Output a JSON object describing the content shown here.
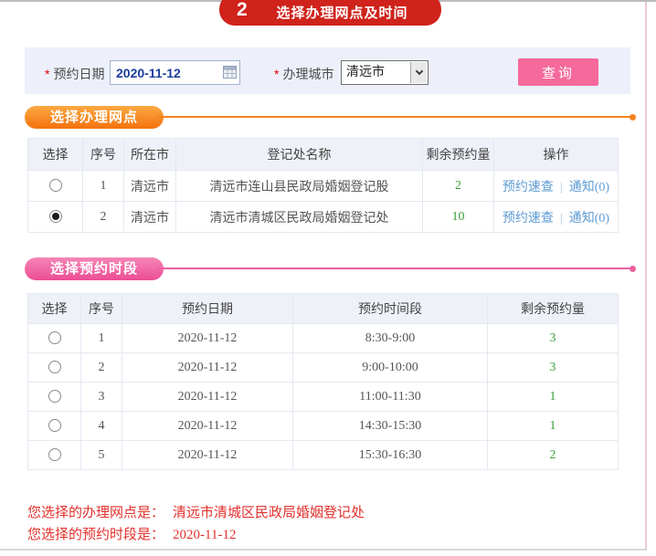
{
  "banner": {
    "step_number": "2",
    "title": "选择办理网点及时间"
  },
  "filter_bar": {
    "required_marker": "*",
    "date_label": "预约日期",
    "date_value": "2020-11-12",
    "city_label": "办理城市",
    "city_value": "清远市",
    "query_button": "查询"
  },
  "site_section": {
    "title": "选择办理网点",
    "table": {
      "headers": [
        "选择",
        "序号",
        "所在市",
        "登记处名称",
        "剩余预约量",
        "操作"
      ],
      "link_labels": {
        "quick_check": "预约速查",
        "separator": "|",
        "notice": "通知(0)"
      },
      "rows": [
        {
          "seq": "1",
          "city": "清远市",
          "name": "清远市连山县民政局婚姻登记股",
          "remaining": "2",
          "selected": false
        },
        {
          "seq": "2",
          "city": "清远市",
          "name": "清远市清城区民政局婚姻登记处",
          "remaining": "10",
          "selected": true
        }
      ]
    }
  },
  "time_section": {
    "title": "选择预约时段",
    "table": {
      "headers": [
        "选择",
        "序号",
        "预约日期",
        "预约时间段",
        "剩余预约量"
      ],
      "rows": [
        {
          "seq": "1",
          "date": "2020-11-12",
          "time": "8:30-9:00",
          "remaining": "3",
          "selected": false
        },
        {
          "seq": "2",
          "date": "2020-11-12",
          "time": "9:00-10:00",
          "remaining": "3",
          "selected": false
        },
        {
          "seq": "3",
          "date": "2020-11-12",
          "time": "11:00-11:30",
          "remaining": "1",
          "selected": false
        },
        {
          "seq": "4",
          "date": "2020-11-12",
          "time": "14:30-15:30",
          "remaining": "1",
          "selected": false
        },
        {
          "seq": "5",
          "date": "2020-11-12",
          "time": "15:30-16:30",
          "remaining": "2",
          "selected": false
        }
      ]
    }
  },
  "summary": {
    "site_label": "您选择的办理网点是：",
    "site_value": "清远市清城区民政局婚姻登记处",
    "time_label": "您选择的预约时段是：",
    "time_value": "2020-11-12"
  },
  "colors": {
    "banner_red": "#cf231c",
    "button_pink": "#f5699b",
    "section_orange": "#f58220",
    "section_pink": "#ed4d94",
    "remaining_green": "#3aa03a",
    "link_blue": "#5e9bd3",
    "summary_red": "#e2312d",
    "filter_bar_bg": "#edf0fa",
    "table_header_bg": "#eef1f8"
  }
}
